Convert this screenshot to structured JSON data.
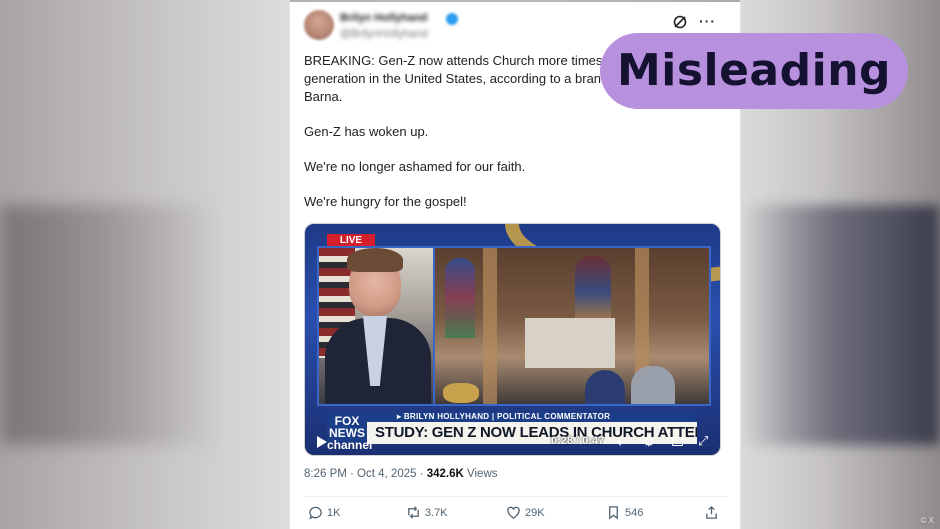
{
  "tweet": {
    "username": "Brilyn Hollyhand",
    "handle": "@BrilynHollyhand",
    "paragraphs": [
      "BREAKING: Gen-Z now attends Church more times",
      "generation in the United States, according to a bran",
      "Barna.",
      "Gen-Z has woken up.",
      "We're no longer ashamed for our faith.",
      "We're hungry for the gospel!"
    ],
    "timestamp": "8:26 PM · Oct 4, 2025 · ",
    "views_count": "342.6K",
    "views_label": "Views"
  },
  "video": {
    "live_label": "LIVE",
    "network_logo": "FOX NEWS channel",
    "name_bar": "▸ BRILYN HOLLYHAND | POLITICAL COMMENTATOR",
    "headline": "STUDY: GEN Z NOW LEADS IN CHURCH ATTENDANCE",
    "timecode": "0:28 / 0:47"
  },
  "actions": {
    "replies": "1K",
    "reposts": "3.7K",
    "likes": "29K",
    "bookmarks": "546"
  },
  "overlay": {
    "badge": "Misleading",
    "credit": "© X",
    "badge_color": "#b791de"
  }
}
